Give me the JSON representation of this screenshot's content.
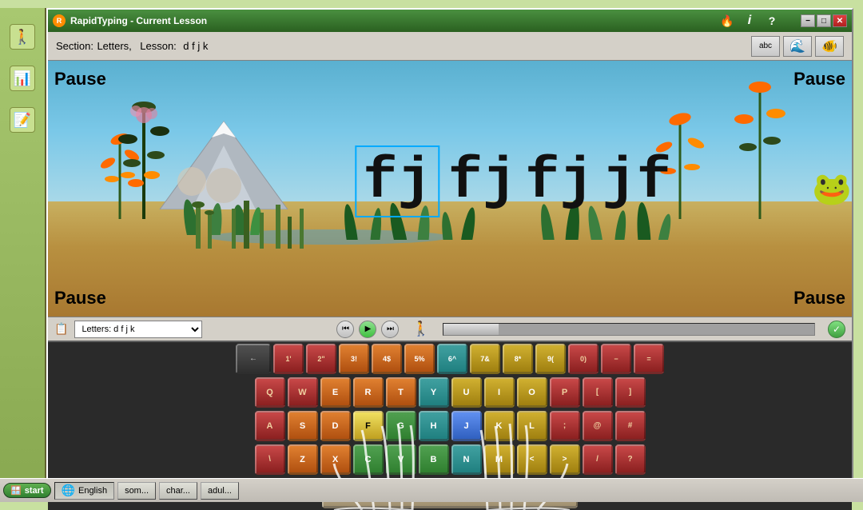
{
  "app": {
    "title": "RapidTyping - Current Lesson",
    "section_label": "Section:",
    "section_value": "Letters,",
    "lesson_label": "Lesson:",
    "lesson_value": "d f j k"
  },
  "controls": {
    "pause_topleft": "Pause",
    "pause_topright": "Pause",
    "pause_bottomleft": "Pause",
    "pause_bottomright": "Pause"
  },
  "typing": {
    "chars": [
      "fj",
      "fj",
      "fj",
      "jf"
    ]
  },
  "lesson_select": {
    "value": "Letters: d f j k",
    "placeholder": "Letters: d f j k"
  },
  "keyboard": {
    "row0": [
      "←",
      "1'",
      "2\"",
      "3!",
      "4$",
      "5%",
      "6^",
      "7&",
      "8*",
      "9(",
      "0)",
      "−",
      "="
    ],
    "row1": [
      "Q",
      "W",
      "E",
      "R",
      "T",
      "Y",
      "U",
      "I",
      "O",
      "P",
      "[",
      "]"
    ],
    "row2": [
      "A",
      "S",
      "D",
      "F",
      "G",
      "H",
      "J",
      "K",
      "L",
      ";",
      "@",
      "#"
    ],
    "row3": [
      "\\",
      "Z",
      "X",
      "C",
      "V",
      "B",
      "N",
      "M",
      "<",
      ">",
      "?",
      "/"
    ]
  },
  "bottom_taskbar": {
    "start_label": "start",
    "english_label": "English",
    "item1": "som...",
    "item2": "char...",
    "item3": "adul..."
  },
  "title_bar_icons": {
    "icon1": "🔥",
    "icon2": "ℹ",
    "icon3": "?"
  },
  "window_controls": {
    "minimize": "−",
    "maximize": "□",
    "close": "✕"
  }
}
